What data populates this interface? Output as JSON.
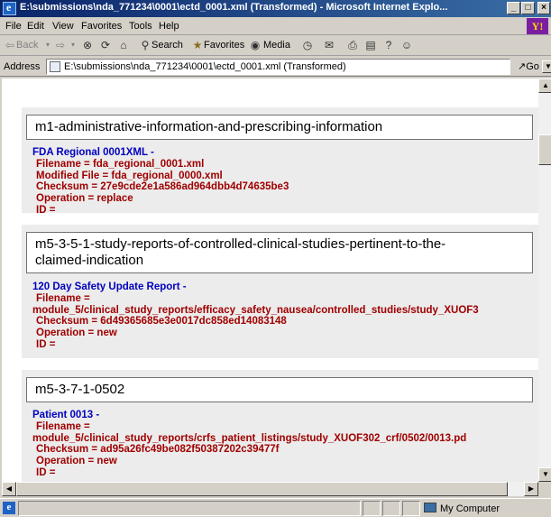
{
  "window": {
    "title": "E:\\submissions\\nda_771234\\0001\\ectd_0001.xml (Transformed) - Microsoft Internet Explo...",
    "min_glyph": "_",
    "max_glyph": "□",
    "close_glyph": "×"
  },
  "menu": [
    "File",
    "Edit",
    "View",
    "Favorites",
    "Tools",
    "Help"
  ],
  "toolbar": {
    "back": "Back",
    "search": "Search",
    "favorites": "Favorites",
    "media": "Media"
  },
  "address": {
    "label": "Address",
    "value": "E:\\submissions\\nda_771234\\0001\\ectd_0001.xml (Transformed)",
    "go": "Go"
  },
  "sections": [
    {
      "heading": "m1-administrative-information-and-prescribing-information",
      "doc_title": "FDA Regional 0001XML -",
      "lines": [
        "Filename = fda_regional_0001.xml",
        "Modified File = fda_regional_0000.xml",
        "Checksum = 27e9cde2e1a586ad964dbb4d74635be3",
        "Operation = replace",
        "ID ="
      ]
    },
    {
      "heading_1": "m5-3-5-1-study-reports-of-controlled-clinical-studies-pertinent-to-the-",
      "heading_2": "claimed-indication",
      "doc_title": "120 Day Safety Update Report -",
      "lines": [
        "Filename =",
        "module_5/clinical_study_reports/efficacy_safety_nausea/controlled_studies/study_XUOF3",
        "Checksum = 6d49365685e3e0017dc858ed14083148",
        "Operation = new",
        "ID ="
      ]
    },
    {
      "heading": "m5-3-7-1-0502",
      "doc_title": "Patient 0013 -",
      "lines": [
        "Filename =",
        "module_5/clinical_study_reports/crfs_patient_listings/study_XUOF302_crf/0502/0013.pd",
        "Checksum = ad95a26fc49be082f50387202c39477f",
        "Operation = new",
        "ID ="
      ]
    }
  ],
  "status": {
    "zone": "My Computer"
  }
}
